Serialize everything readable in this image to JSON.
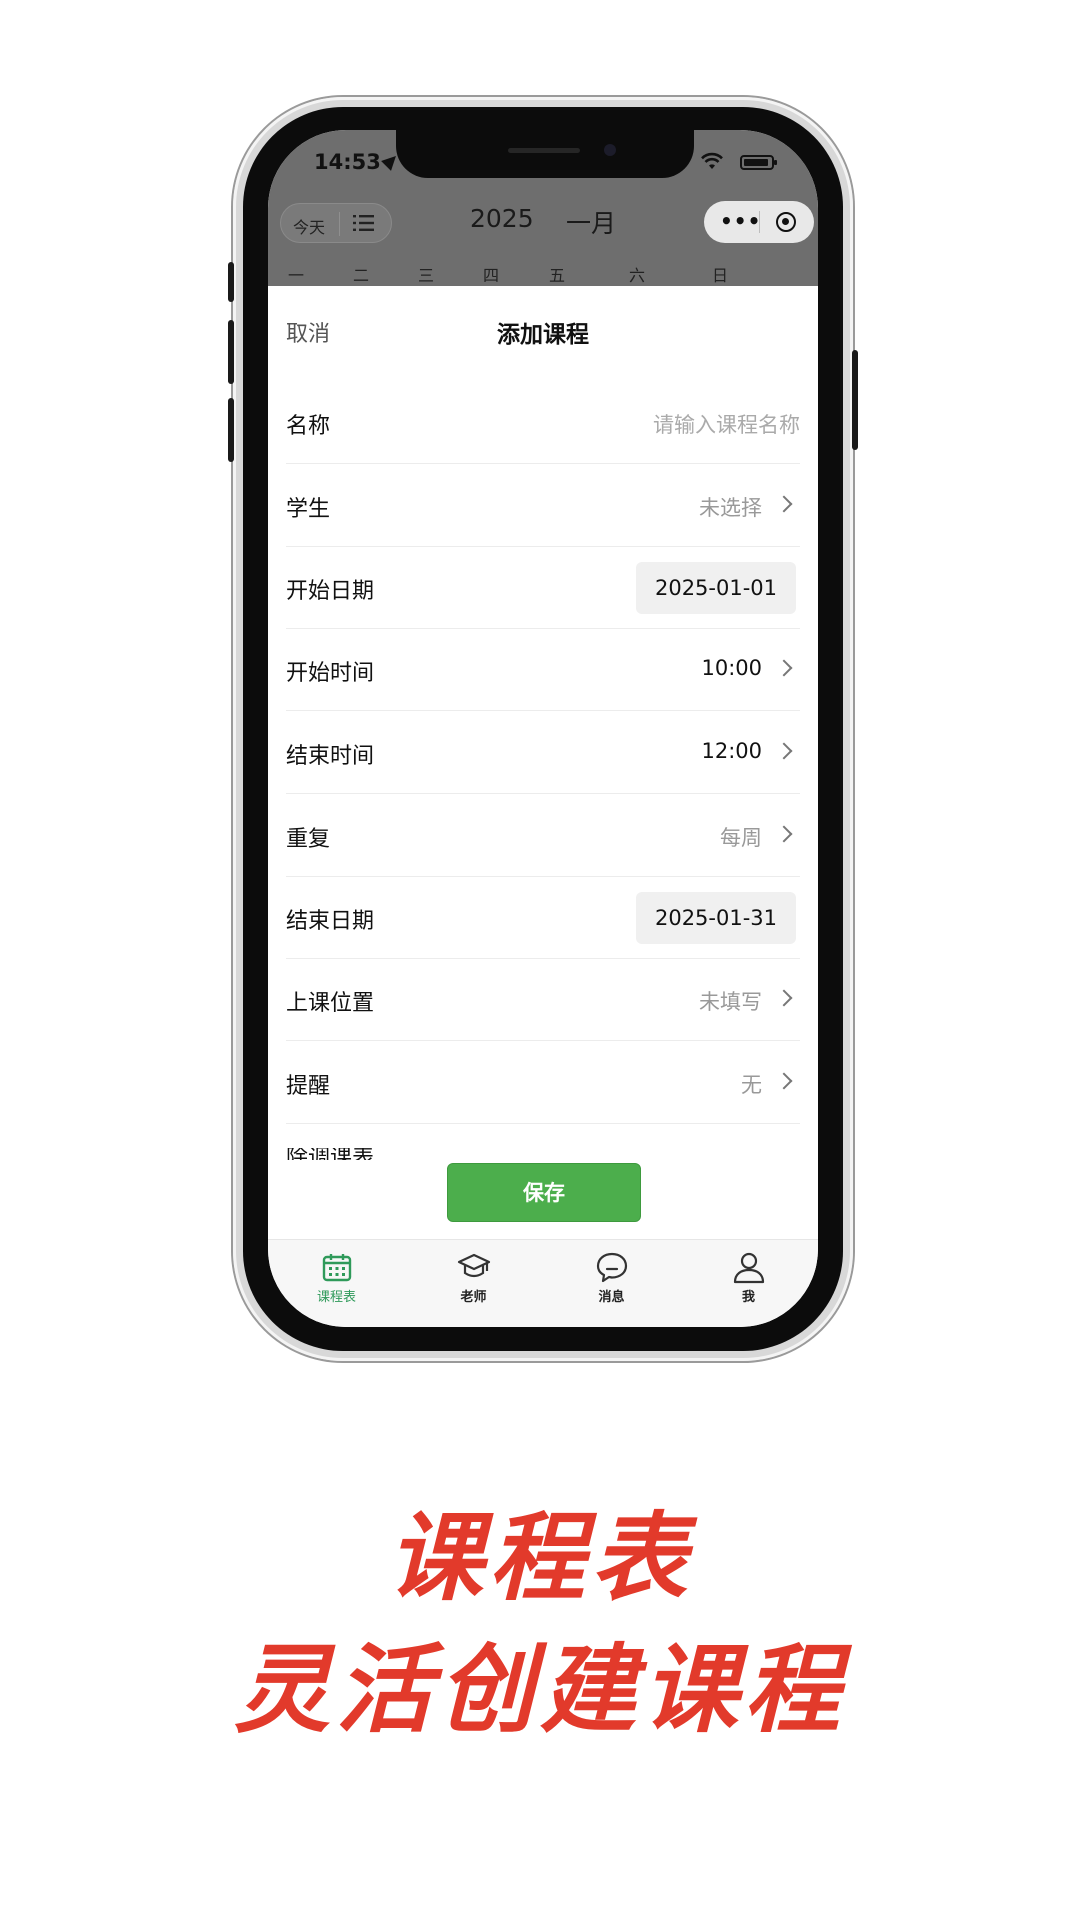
{
  "status_bar": {
    "time": "14:53"
  },
  "calendar_header": {
    "today_label": "今天",
    "year": "2025",
    "month": "一月",
    "weekdays": [
      "一",
      "二",
      "三",
      "四",
      "五",
      "六",
      "日"
    ]
  },
  "sheet": {
    "cancel_label": "取消",
    "title": "添加课程",
    "fields": [
      {
        "label": "名称",
        "placeholder": "请输入课程名称"
      },
      {
        "label": "学生",
        "value": "未选择"
      },
      {
        "label": "开始日期",
        "value": "2025-01-01"
      },
      {
        "label": "开始时间",
        "value": "10:00"
      },
      {
        "label": "结束时间",
        "value": "12:00"
      },
      {
        "label": "重复",
        "value": "每周"
      },
      {
        "label": "结束日期",
        "value": "2025-01-31"
      },
      {
        "label": "上课位置",
        "value": "未填写"
      },
      {
        "label": "提醒",
        "value": "无"
      }
    ],
    "truncated_label": "除调课表",
    "save_label": "保存"
  },
  "tabbar": {
    "items": [
      {
        "label": "课程表",
        "icon": "calendar-icon",
        "active": true
      },
      {
        "label": "老师",
        "icon": "graduation-cap-icon",
        "active": false
      },
      {
        "label": "消息",
        "icon": "chat-bubble-icon",
        "active": false
      },
      {
        "label": "我",
        "icon": "person-icon",
        "active": false
      }
    ]
  },
  "captions": {
    "line1": "课程表",
    "line2": "灵活创建课程"
  },
  "colors": {
    "accent_green": "#4cae4c",
    "tab_active": "#2f9a5a",
    "caption_red": "#e23a2b"
  }
}
